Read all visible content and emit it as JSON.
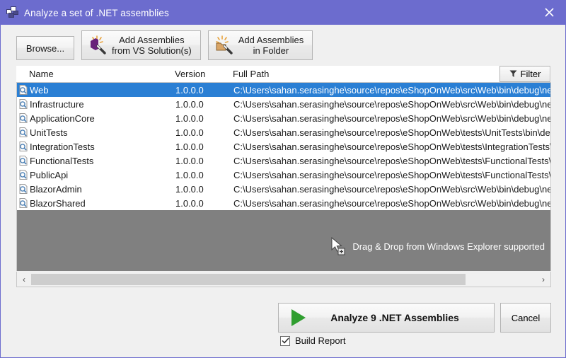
{
  "window": {
    "title": "Analyze a set of .NET assemblies",
    "icon": "assemblies-icon",
    "close_label": "✕",
    "titlebar_color": "#6C6CCE"
  },
  "toolbar": {
    "browse_label": "Browse...",
    "add_from_vs_label": "Add Assemblies\nfrom VS Solution(s)",
    "add_in_folder_label": "Add Assemblies\nin Folder"
  },
  "list": {
    "columns": [
      "Name",
      "Version",
      "Full Path"
    ],
    "filter_label": "Filter",
    "selected_index": 0,
    "rows": [
      {
        "name": "Web",
        "version": "1.0.0.0",
        "path": "C:\\Users\\sahan.serasinghe\\source\\repos\\eShopOnWeb\\src\\Web\\bin\\debug\\netcoreapp"
      },
      {
        "name": "Infrastructure",
        "version": "1.0.0.0",
        "path": "C:\\Users\\sahan.serasinghe\\source\\repos\\eShopOnWeb\\src\\Web\\bin\\debug\\netcoreapp"
      },
      {
        "name": "ApplicationCore",
        "version": "1.0.0.0",
        "path": "C:\\Users\\sahan.serasinghe\\source\\repos\\eShopOnWeb\\src\\Web\\bin\\debug\\netcoreapp"
      },
      {
        "name": "UnitTests",
        "version": "1.0.0.0",
        "path": "C:\\Users\\sahan.serasinghe\\source\\repos\\eShopOnWeb\\tests\\UnitTests\\bin\\debug\\netc"
      },
      {
        "name": "IntegrationTests",
        "version": "1.0.0.0",
        "path": "C:\\Users\\sahan.serasinghe\\source\\repos\\eShopOnWeb\\tests\\IntegrationTests\\bin\\debu"
      },
      {
        "name": "FunctionalTests",
        "version": "1.0.0.0",
        "path": "C:\\Users\\sahan.serasinghe\\source\\repos\\eShopOnWeb\\tests\\FunctionalTests\\bin\\debu"
      },
      {
        "name": "PublicApi",
        "version": "1.0.0.0",
        "path": "C:\\Users\\sahan.serasinghe\\source\\repos\\eShopOnWeb\\tests\\FunctionalTests\\bin\\debu"
      },
      {
        "name": "BlazorAdmin",
        "version": "1.0.0.0",
        "path": "C:\\Users\\sahan.serasinghe\\source\\repos\\eShopOnWeb\\src\\Web\\bin\\debug\\netcoreapp"
      },
      {
        "name": "BlazorShared",
        "version": "1.0.0.0",
        "path": "C:\\Users\\sahan.serasinghe\\source\\repos\\eShopOnWeb\\src\\Web\\bin\\debug\\netcoreapp"
      }
    ],
    "drop_hint": "Drag & Drop from Windows Explorer supported",
    "empty_area_color": "#808080",
    "selection_color": "#2A7FD4"
  },
  "scrollbar": {
    "left_arrow": "‹",
    "right_arrow": "›",
    "thumb_percent": 86
  },
  "footer": {
    "analyze_label": "Analyze 9 .NET Assemblies",
    "cancel_label": "Cancel",
    "build_report_label": "Build Report",
    "build_report_checked": true,
    "play_color": "#2F9E2F"
  }
}
